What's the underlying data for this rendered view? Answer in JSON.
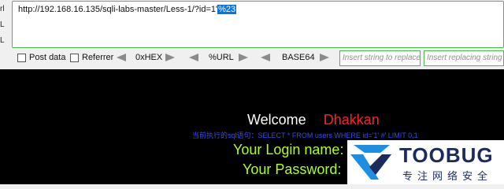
{
  "toolbar": {
    "side_labels": [
      "rl",
      "L",
      "L"
    ],
    "url": {
      "prefix": "http://192.168.16.135/sqli-labs-master/Less-1/?id=1'",
      "selected": "%23"
    },
    "post_data_label": "Post data",
    "referrer_label": "Referrer",
    "hex_label": "0xHEX",
    "url_label": "%URL",
    "base64_label": "BASE64",
    "insert_placeholder": "Insert string to replace",
    "replacing_placeholder": "Insert replacing string"
  },
  "page": {
    "welcome": "Welcome",
    "name": "Dhakkan",
    "query": "当前执行的sql语句：SELECT * FROM users WHERE id='1' #' LIMIT 0,1",
    "login": "Your Login name:",
    "password": "Your Password:"
  },
  "logo": {
    "name": "TOOBUG",
    "subtitle": "专注网络安全"
  },
  "colors": {
    "border_green": "#4fb54f",
    "selection_blue": "#0a74da",
    "welcome_name_red": "#ff2020",
    "result_green": "#aaff22",
    "query_blue": "#3b4be0",
    "logo_blue": "#1d2a5e",
    "logo_accent": "#1e8fe0"
  }
}
